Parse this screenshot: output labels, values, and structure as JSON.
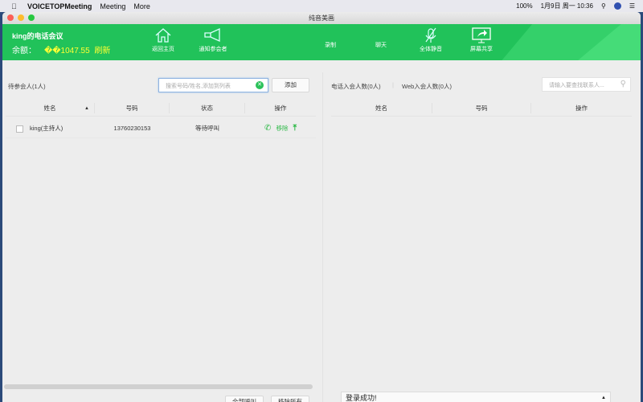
{
  "menubar": {
    "app": "VOICETOPMeeting",
    "menus": [
      "Meeting",
      "More"
    ],
    "battery": "100%",
    "datetime": "1月9日 周一 10:36"
  },
  "window": {
    "title": "纯音美画"
  },
  "header": {
    "conference_title": "king的电话会议",
    "balance_label": "余额：",
    "balance_value": "��1047.55",
    "refresh": "刷新",
    "tools": {
      "home": "返回主页",
      "notify": "通知参会者",
      "record": "录制",
      "chat": "聊天",
      "mute_all": "全体静音",
      "screen_share": "屏幕共享"
    }
  },
  "left": {
    "pending_label": "待参会人(1人)",
    "search_placeholder": "搜索号码/姓名,添加到列表",
    "add_button": "添加",
    "columns": [
      "姓名",
      "号码",
      "状态",
      "操作"
    ],
    "rows": [
      {
        "name": "king(主持人)",
        "number": "13760230153",
        "status": "等待呼叫",
        "remove": "移除"
      }
    ],
    "call_all": "全部呼叫",
    "remove_all": "移除所有"
  },
  "right": {
    "phone_count": "电话入会人数(0人)",
    "web_count": "Web入会人数(0人)",
    "search_placeholder": "请输入要查找联系人...",
    "columns": [
      "姓名",
      "号码",
      "操作"
    ],
    "status_message": "登录成功!"
  }
}
